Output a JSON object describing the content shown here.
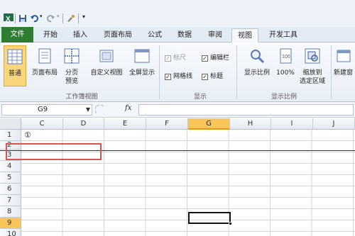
{
  "quick_access": {
    "icons": [
      "excel-logo-icon",
      "save-icon",
      "undo-icon",
      "redo-icon",
      "customize-icon"
    ]
  },
  "tabs": [
    {
      "label": "文件"
    },
    {
      "label": "开始"
    },
    {
      "label": "插入"
    },
    {
      "label": "页面布局"
    },
    {
      "label": "公式"
    },
    {
      "label": "数据"
    },
    {
      "label": "审阅"
    },
    {
      "label": "视图"
    },
    {
      "label": "开发工具"
    }
  ],
  "ribbon": {
    "workbook_views": {
      "normal": "普通",
      "page_layout": "页面布局",
      "page_break_1": "分页",
      "page_break_2": "预览",
      "custom_views": "自定义视图",
      "full_screen": "全屏显示",
      "group_label": "工作簿视图"
    },
    "show": {
      "ruler": "标尺",
      "formula_bar": "编辑栏",
      "gridlines": "网格线",
      "headings": "标题",
      "group_label": "显示"
    },
    "zoom": {
      "zoom": "显示比例",
      "hundred": "100%",
      "zoom_selection_1": "缩放到",
      "zoom_selection_2": "选定区域",
      "group_label": "显示比例"
    },
    "window": {
      "new_window": "新建窗"
    }
  },
  "formula_bar": {
    "name_box": "G9",
    "fx_label": "fx",
    "value": ""
  },
  "grid": {
    "columns": [
      "C",
      "D",
      "E",
      "F",
      "G",
      "H",
      "I",
      "J"
    ],
    "rows": [
      "1",
      "2",
      "3",
      "4",
      "5",
      "6",
      "7",
      "8",
      "9",
      "10"
    ],
    "selected_column": "G",
    "selected_row": "9",
    "cell_c1": "①"
  }
}
